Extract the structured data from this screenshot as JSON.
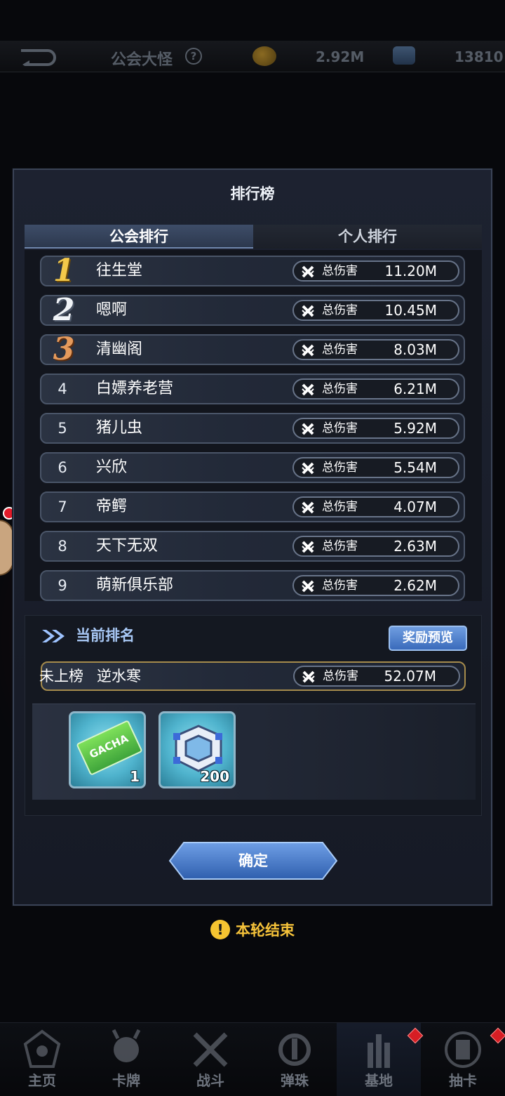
{
  "topbar": {
    "title": "公会大怪",
    "help": "?",
    "coins": "2.92M",
    "gems": "13810"
  },
  "modal": {
    "title": "排行榜",
    "tabs": [
      {
        "label": "公会排行",
        "active": true
      },
      {
        "label": "个人排行",
        "active": false
      }
    ],
    "damage_label": "总伤害",
    "rankings": [
      {
        "rank": "1",
        "name": "往生堂",
        "damage": "11.20M"
      },
      {
        "rank": "2",
        "name": "嗯啊",
        "damage": "10.45M"
      },
      {
        "rank": "3",
        "name": "清幽阁",
        "damage": "8.03M"
      },
      {
        "rank": "4",
        "name": "白嫖养老营",
        "damage": "6.21M"
      },
      {
        "rank": "5",
        "name": "猪儿虫",
        "damage": "5.92M"
      },
      {
        "rank": "6",
        "name": "兴欣",
        "damage": "5.54M"
      },
      {
        "rank": "7",
        "name": "帝鳄",
        "damage": "4.07M"
      },
      {
        "rank": "8",
        "name": "天下无双",
        "damage": "2.63M"
      },
      {
        "rank": "9",
        "name": "萌新俱乐部",
        "damage": "2.62M"
      }
    ],
    "current": {
      "title": "当前排名",
      "reward_preview": "奖励预览",
      "status": "未上榜",
      "name": "逆水寒",
      "damage": "52.07M",
      "rewards": [
        {
          "icon": "gacha-ticket-icon",
          "label": "GACHA",
          "qty": "1"
        },
        {
          "icon": "frame-material-icon",
          "qty": "200"
        }
      ]
    },
    "confirm": "确定"
  },
  "notice": "本轮结束",
  "nav": [
    {
      "label": "主页",
      "icon": "home-icon",
      "badge": false,
      "active": false
    },
    {
      "label": "卡牌",
      "icon": "card-icon",
      "badge": false,
      "active": false
    },
    {
      "label": "战斗",
      "icon": "battle-icon",
      "badge": false,
      "active": false
    },
    {
      "label": "弹珠",
      "icon": "pinball-icon",
      "badge": false,
      "active": false
    },
    {
      "label": "基地",
      "icon": "base-icon",
      "badge": true,
      "active": true
    },
    {
      "label": "抽卡",
      "icon": "gacha-icon",
      "badge": true,
      "active": false
    }
  ],
  "colors": {
    "accent_blue": "#3a6bbb",
    "gold": "#f6c33a",
    "panel": "#1d2230"
  }
}
